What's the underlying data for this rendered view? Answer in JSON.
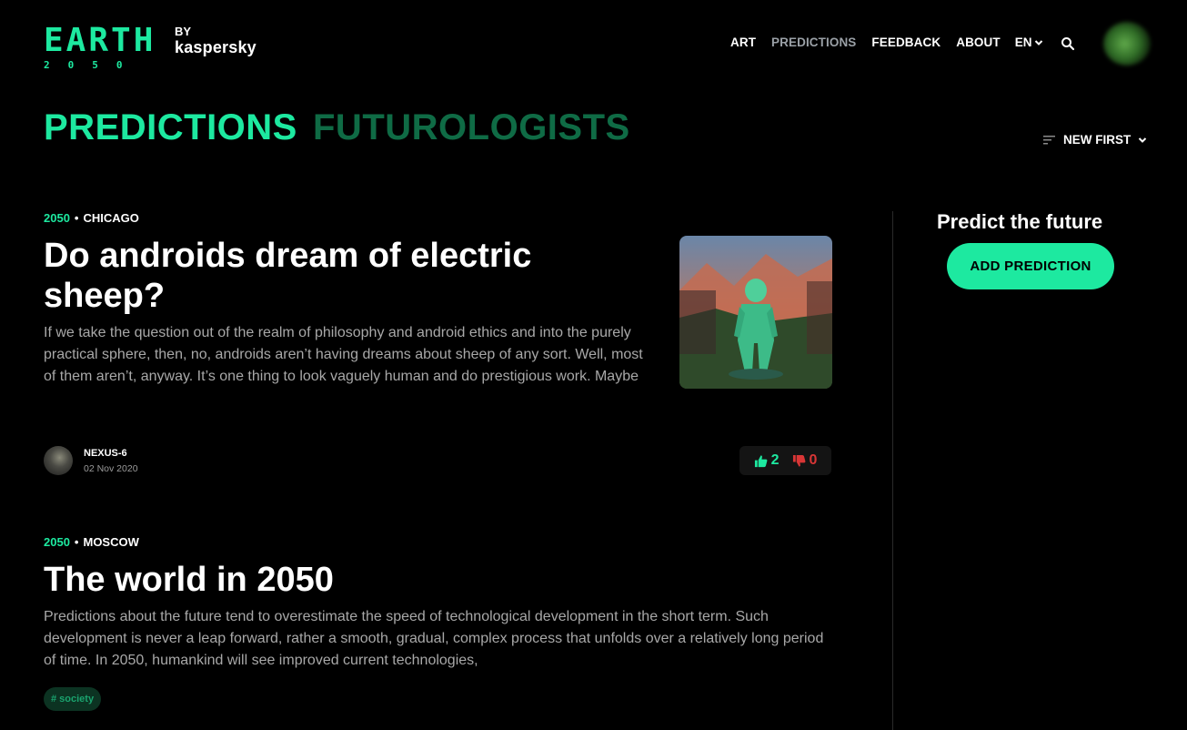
{
  "header": {
    "logo_word": "EARTH",
    "logo_year": "2050",
    "logo_by": "BY",
    "logo_brand": "kaspersky",
    "nav": [
      {
        "label": "ART"
      },
      {
        "label": "PREDICTIONS"
      },
      {
        "label": "FEEDBACK"
      },
      {
        "label": "ABOUT"
      }
    ],
    "language": "EN"
  },
  "tabs": {
    "active": "PREDICTIONS",
    "inactive": "FUTUROLOGISTS"
  },
  "sort": {
    "label": "NEW FIRST"
  },
  "posts": [
    {
      "year": "2050",
      "city": "CHICAGO",
      "title": "Do androids dream of electric sheep?",
      "excerpt": "If we take the question out of the realm of philosophy and android ethics and into the purely practical sphere, then, no, androids aren’t having dreams about sheep of any sort. Well, most of them aren’t, anyway.  It’s one thing to look vaguely human and do prestigious work. Maybe",
      "author": "NEXUS-6",
      "date": "02 Nov 2020",
      "likes": "2",
      "dislikes": "0"
    },
    {
      "year": "2050",
      "city": "MOSCOW",
      "title": "The world in 2050",
      "excerpt": "Predictions about the future tend to overestimate the speed of technological development in the short term. Such development is never a leap forward, rather a smooth, gradual, complex process that unfolds over a relatively long period of time.  In 2050, humankind will see improved current technologies,",
      "tag": "# society"
    }
  ],
  "sidebar": {
    "title": "Predict the future",
    "button": "ADD PREDICTION"
  },
  "colors": {
    "accent": "#1de9a0",
    "accent_dim": "#0f6b45",
    "dislike": "#d93636",
    "background": "#000000"
  }
}
